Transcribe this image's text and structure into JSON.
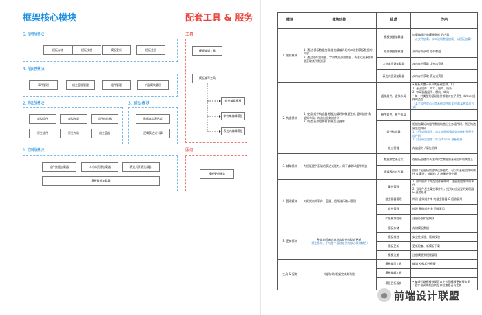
{
  "left": {
    "title": "框架核心模块",
    "sections": {
      "update": {
        "label": "5. 更新模块",
        "items": [
          "模板存储",
          "模板校验",
          "模板更新",
          "模板注册"
        ]
      },
      "manage": {
        "label": "4. 管理模块",
        "items": [
          "事件管理",
          "组主容器管理",
          "组件管理",
          "扩展模块管理"
        ]
      },
      "build": {
        "label": "2. 构造模块",
        "items": [
          "虚拟组件",
          "虚拟布局",
          "组件构造器",
          "原生组件",
          "原生布局",
          "组主容器"
        ]
      },
      "assist": {
        "label": "3. 辅助模块",
        "items": [
          "数据绑定表达式",
          "逻辑表达式引擎"
        ]
      },
      "load": {
        "label": "1. 加载模块",
        "items": [
          "组件数据加载器",
          "字符串资源加载器",
          "表达式资源加载器",
          "模板数据加载器"
        ]
      }
    }
  },
  "right": {
    "title": "配套工具 & 服务",
    "tools": {
      "label": "工具",
      "top": "模板编辑工具",
      "mid": "模板编写工具",
      "items": [
        "组件编辑模板",
        "字符串编辑模板",
        "表达式编辑模板"
      ]
    },
    "service": {
      "label": "服务",
      "items": [
        "模板更新服务"
      ]
    }
  },
  "table": {
    "headers": [
      "模块",
      "模块功能",
      "组成",
      "作用"
    ],
    "rows": [
      {
        "module": "1. 加载模块",
        "func": "1. 通过 模板数据加载器 加载编译后的二进制模板数据的内容\n2. 通过组件加载器、字符串资源加载器、表达式资源加载器获取其所需资源",
        "parts": [
          {
            "name": "模板数据加载器",
            "role": "加载编译后的模板数据 的内容",
            "note": "（从文件加载、从二进制数据加载、以模板加载）"
          },
          {
            "name": "组件数据加载器",
            "role": "从内存中获取 组件数据"
          },
          {
            "name": "字符串资源加载器",
            "role": "从内存中获取 字符串资源"
          },
          {
            "name": "表达式资源加载器",
            "role": "从内存中获取 表达式资源"
          }
        ]
      },
      {
        "module": "2. 构造模块",
        "func": "1. 使用 组件构造器 根据加载好的数据生成 虚拟组件 和 虚拟布局，构造出业务组件树\n2. 构造 业务组件树 到原生容器中",
        "parts": [
          {
            "name": "虚拟组件、虚拟布局",
            "role": "• 模板内置一系列的基础组件，如\n  1. 基于组件：文本、图片、线条\n  2. 布局容器组件：横向、纵向\n• 每一种类型的基础组件都能对应了原生 Native 组件的类型",
            "note": "（某个组件是否只是基础组件的 对应的某种实现方式）"
          },
          {
            "name": "原生组件、原生布局",
            "role": ""
          },
          {
            "name": "组件构造器",
            "role": "根据加载好的组件数据构造出业务组件树，然后构造原生组件树",
            "note": "1. 对于虚拟组件：自定义数据格式如何映射到原生组件树\n2. 对于原生组件：作为 Native 模板组件"
          },
          {
            "name": "组主容器",
            "role": "存放虚拟 / 原生组件"
          }
        ]
      },
      {
        "module": "3. 辅助模块",
        "func": "为模板提供基础的表达式能力，用于辅助UI组件构造",
        "parts": [
          {
            "name": "数据绑定表达式",
            "role": "在模板里使用表达式绑定数据到基础组件的属性上"
          },
          {
            "name": "逻辑表达式引擎",
            "role": "提供了轻量级的逻辑运算能力，可以对基础组件的属性 & 事件、前端的 UI 结果进行处理"
          }
        ]
      },
      {
        "module": "4. 管理模块",
        "func": "对框架内的事件、容器、组件进行统一管理",
        "parts": [
          {
            "name": "事件管理",
            "role": "1. 用户操作了某类组件事件时：注册到组件内的事件\n2. 当组件发生某些事件时，找到对应类型的处理器 & 调用处理"
          },
          {
            "name": "组主容器管理",
            "role": "构建 虚拟组件库 的组主容器 & 回收复用"
          },
          {
            "name": "组件管理",
            "role": "构建 基础组件 & 回收复用"
          },
          {
            "name": "扩展模块管理",
            "role": "注册外部扩展模块"
          }
        ]
      },
      {
        "module": "5. 更新模块",
        "func": "整体协同来完成业务组件的动态更新",
        "func_note": "（模主模块、不与整个基础组件的核心模块耦合）",
        "parts": [
          {
            "name": "模板存储",
            "role": "存储模板数据"
          },
          {
            "name": "模板校验",
            "role": "安全性校验、版本校验"
          },
          {
            "name": "模板更新",
            "role": "更新检查、新模板下载"
          },
          {
            "name": "模板注册",
            "role": "注册模板到模板管理"
          }
        ]
      },
      {
        "module": "工具 & 服务",
        "func": "外部协助 框架完成其功能",
        "parts": [
          {
            "name": "模板编写工具",
            "role": "编辑 XML组件模板"
          },
          {
            "name": "模板编辑工具",
            "role": ""
          },
          {
            "name": "模板更新服务",
            "role": "• 编译后端模板数据可以上传到模板更新服务里\n• 客户端调用相应的接口检查是否有更新"
          }
        ]
      }
    ]
  },
  "watermark": {
    "text": "前端设计联盟"
  }
}
